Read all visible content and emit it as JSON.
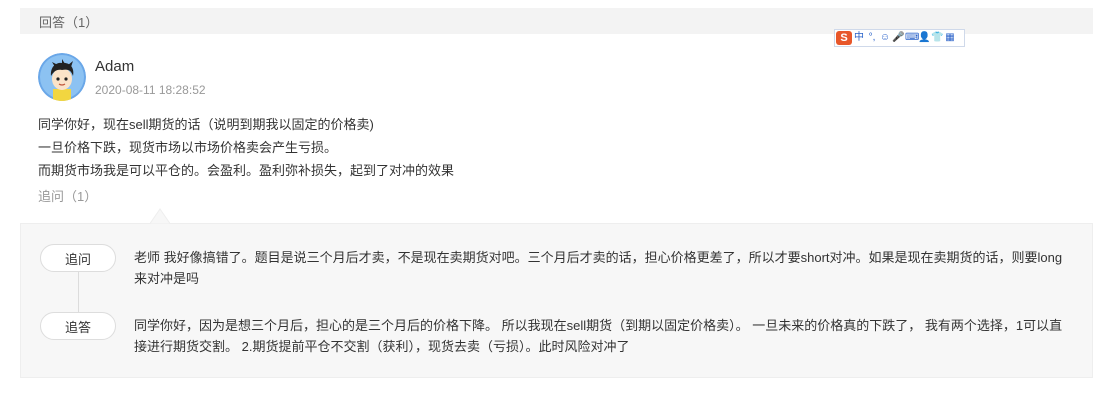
{
  "answers_header": {
    "label": "回答（1）"
  },
  "ime_toolbar": {
    "logo": "S",
    "items": [
      "中",
      "°,",
      "☺",
      "🎤",
      "⌨",
      "👤",
      "👕",
      "▦"
    ]
  },
  "answer": {
    "author": "Adam",
    "timestamp": "2020-08-11 18:28:52",
    "lines": [
      "同学你好，现在sell期货的话（说明到期我以固定的价格卖)",
      "一旦价格下跌，现货市场以市场价格卖会产生亏损。",
      "而期货市场我是可以平仓的。会盈利。盈利弥补损失，起到了对冲的效果"
    ],
    "followup_count_label": "追问（1）"
  },
  "thread": [
    {
      "tag": "追问",
      "text": "老师 我好像搞错了。题目是说三个月后才卖，不是现在卖期货对吧。三个月后才卖的话，担心价格更差了，所以才要short对冲。如果是现在卖期货的话，则要long来对冲是吗"
    },
    {
      "tag": "追答",
      "text": "同学你好，因为是想三个月后，担心的是三个月后的价格下降。 所以我现在sell期货（到期以固定价格卖）。 一旦未来的价格真的下跌了， 我有两个选择，1可以直接进行期货交割。 2.期货提前平仓不交割（获利），现货去卖（亏损）。此时风险对冲了"
    }
  ]
}
